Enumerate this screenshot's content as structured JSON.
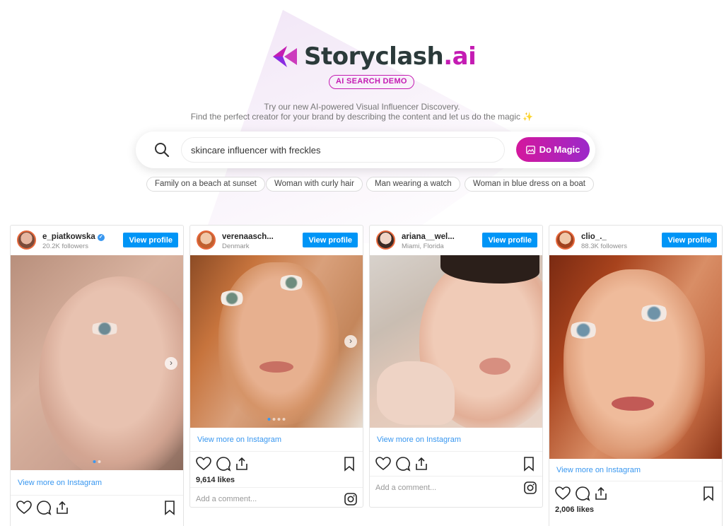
{
  "brand": {
    "name": "Storyclash",
    "suffix": ".ai",
    "accent": "#c41cb3"
  },
  "badge": "AI SEARCH DEMO",
  "tagline": {
    "line1": "Try our new AI-powered Visual Influencer Discovery.",
    "line2": "Find the perfect creator for your brand by describing the content and let us do the magic ✨"
  },
  "search": {
    "value": "skincare influencer with freckles",
    "button_label": "Do Magic",
    "icon": "search-icon"
  },
  "suggestions": [
    "Family on a beach at sunset",
    "Woman with curly hair",
    "Man wearing a watch",
    "Woman in blue dress on a boat"
  ],
  "cards": [
    {
      "username": "e_piatkowska",
      "subtitle": "20.2K followers",
      "verified": true,
      "view_profile": "View profile",
      "more_link": "View more on Instagram"
    },
    {
      "username": "verenaasch...",
      "subtitle": "Denmark",
      "view_profile": "View profile",
      "more_link": "View more on Instagram",
      "likes": "9,614 likes",
      "comment_placeholder": "Add a comment..."
    },
    {
      "username": "ariana__wel...",
      "subtitle": "Miami, Florida",
      "view_profile": "View profile",
      "more_link": "View more on Instagram",
      "comment_placeholder": "Add a comment..."
    },
    {
      "username": "clio_._",
      "subtitle": "88.3K followers",
      "view_profile": "View profile",
      "more_link": "View more on Instagram",
      "likes": "2,006 likes"
    }
  ],
  "colors": {
    "button_blue": "#0095f6",
    "link_blue": "#3897f0",
    "magic_gradient_start": "#d4179d",
    "magic_gradient_end": "#9b29c9"
  }
}
